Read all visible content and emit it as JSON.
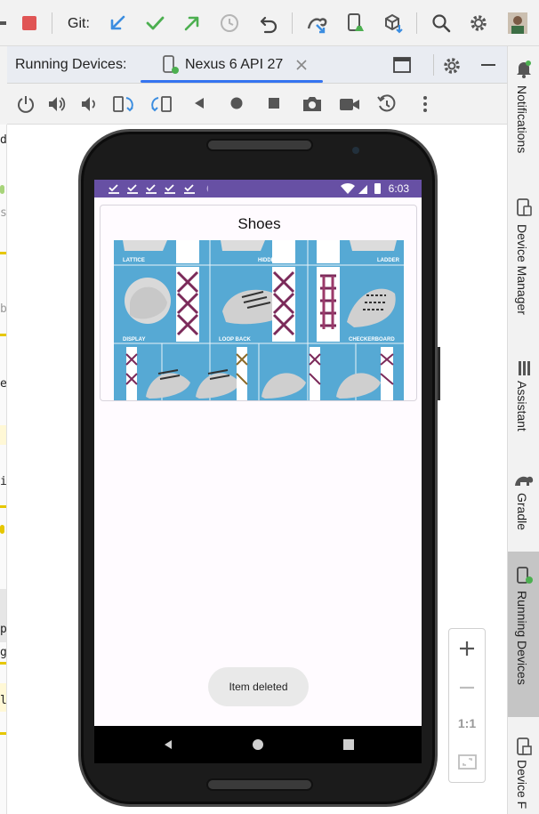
{
  "toolbar": {
    "git_label": "Git:"
  },
  "tabs": {
    "running_devices_label": "Running Devices:",
    "device_tab_label": "Nexus 6 API 27"
  },
  "device_screen": {
    "status_time": "6:03",
    "card_title": "Shoes",
    "image_labels": [
      "LATTICE",
      "HIDDEN KNOT",
      "LADDER",
      "DISPLAY",
      "LOOP BACK",
      "CHECKERBOARD"
    ],
    "toast_text": "Item deleted"
  },
  "zoom": {
    "one_to_one_label": "1:1"
  },
  "right_sidebar": {
    "items": [
      {
        "label": "Notifications"
      },
      {
        "label": "Device Manager"
      },
      {
        "label": "Assistant"
      },
      {
        "label": "Gradle"
      },
      {
        "label": "Running Devices"
      },
      {
        "label": "Device F"
      }
    ]
  },
  "gutter_chars": [
    "d",
    "s",
    "b",
    "e",
    "i",
    "p",
    "g",
    "l"
  ],
  "colors": {
    "status_bar": "#6750a4",
    "tab_underline": "#3574f0",
    "stop_red": "#e05555",
    "git_blue": "#3b8de0",
    "git_green": "#4caf50"
  }
}
